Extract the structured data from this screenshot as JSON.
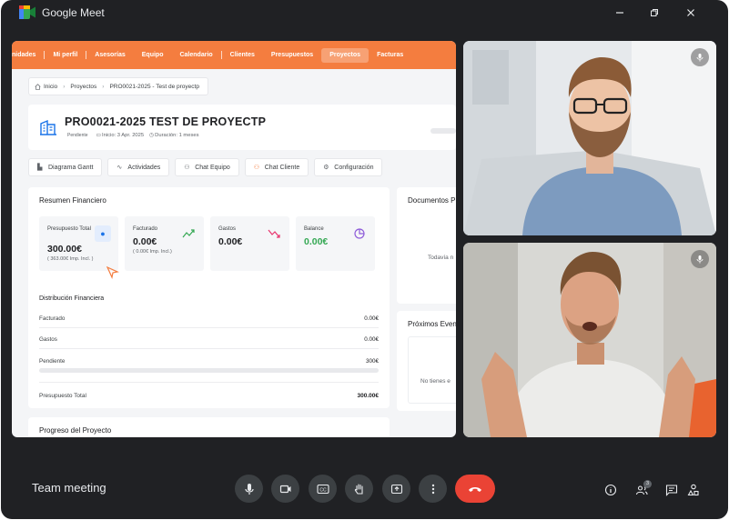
{
  "window": {
    "title": "Google Meet"
  },
  "app": {
    "nav": {
      "items": [
        "nidades",
        "Mi perfil",
        "Asesorías",
        "Equipo",
        "Calendario",
        "Clientes",
        "Presupuestos",
        "Proyectos",
        "Facturas"
      ],
      "active": "Proyectos"
    },
    "breadcrumb": [
      "Inicio",
      "Proyectos",
      "PRO0021-2025 - Test de proyectp"
    ],
    "project": {
      "title": "PRO0021-2025 TEST DE PROYECTP",
      "status": "Pendiente",
      "start": "Inicio: 3 Apr. 2025",
      "duration": "Duración: 1 meses"
    },
    "tabs": [
      "Diagrama Gantt",
      "Actividades",
      "Chat Equipo",
      "Chat Cliente",
      "Configuración"
    ],
    "financial": {
      "title": "Resumen Financiero",
      "kpis": [
        {
          "label": "Presupuesto Total",
          "value": "300.00€",
          "sub": "( 363.00€ Imp. Incl. )"
        },
        {
          "label": "Facturado",
          "value": "0.00€",
          "sub": "( 0.00€ Imp. Incl.)"
        },
        {
          "label": "Gastos",
          "value": "0.00€",
          "sub": ""
        },
        {
          "label": "Balance",
          "value": "0.00€",
          "sub": ""
        }
      ],
      "distribution": {
        "title": "Distribución Financiera",
        "rows": [
          {
            "label": "Facturado",
            "value": "0.00€"
          },
          {
            "label": "Gastos",
            "value": "0.00€"
          },
          {
            "label": "Pendiente",
            "value": "300€"
          }
        ],
        "total_label": "Presupuesto Total",
        "total_value": "300.00€"
      }
    },
    "documents": {
      "title": "Documentos P",
      "empty": "Todavía n"
    },
    "events": {
      "title": "Próximos Even",
      "empty": "No tienes e"
    },
    "progress": {
      "title": "Progreso del Proyecto"
    }
  },
  "meeting": {
    "name": "Team meeting",
    "participants_count": "3"
  },
  "colors": {
    "accent": "#f47d3f",
    "end_call": "#ea4335",
    "background": "#202124"
  },
  "icons": {
    "controls": [
      "mic-icon",
      "camera-icon",
      "captions-icon",
      "raise-hand-icon",
      "present-icon",
      "more-options-icon",
      "end-call-icon"
    ],
    "right": [
      "info-icon",
      "people-icon",
      "chat-icon",
      "activities-icon"
    ]
  }
}
